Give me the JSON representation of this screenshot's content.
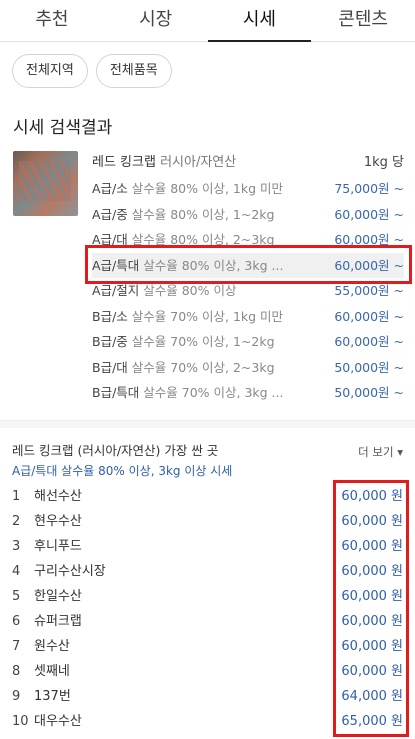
{
  "tabs": [
    "추천",
    "시장",
    "시세",
    "콘텐츠"
  ],
  "active_tab": 2,
  "filters": [
    "전체지역",
    "전체품목"
  ],
  "section_title": "시세 검색결과",
  "product": {
    "name": "레드 킹크랩",
    "origin": "러시아/자연산",
    "unit": "1kg 당"
  },
  "price_rows": [
    {
      "grade": "A급/소",
      "desc": "살수율 80% 이상, 1kg 미만",
      "price": "75,000원 ~"
    },
    {
      "grade": "A급/중",
      "desc": "살수율 80% 이상, 1~2kg",
      "price": "60,000원 ~"
    },
    {
      "grade": "A급/대",
      "desc": "살수율 80% 이상, 2~3kg",
      "price": "60,000원 ~"
    },
    {
      "grade": "A급/특대",
      "desc": "살수율 80% 이상, 3kg ...",
      "price": "60,000원 ~"
    },
    {
      "grade": "A급/절지",
      "desc": "살수율 80% 이상",
      "price": "55,000원 ~"
    },
    {
      "grade": "B급/소",
      "desc": "살수율 70% 이상, 1kg 미만",
      "price": "60,000원 ~"
    },
    {
      "grade": "B급/중",
      "desc": "살수율 70% 이상, 1~2kg",
      "price": "60,000원 ~"
    },
    {
      "grade": "B급/대",
      "desc": "살수율 70% 이상, 2~3kg",
      "price": "50,000원 ~"
    },
    {
      "grade": "B급/특대",
      "desc": "살수율 70% 이상, 3kg ...",
      "price": "50,000원 ~"
    }
  ],
  "cheapest": {
    "heading": "레드 킹크랩 (러시아/자연산) 가장 싼 곳",
    "more": "더 보기 ▾",
    "subheading": "A급/특대 살수율 80% 이상, 3kg 이상 시세",
    "shops": [
      {
        "rank": "1",
        "name": "해선수산",
        "price": "60,000 원"
      },
      {
        "rank": "2",
        "name": "현우수산",
        "price": "60,000 원"
      },
      {
        "rank": "3",
        "name": "후니푸드",
        "price": "60,000 원"
      },
      {
        "rank": "4",
        "name": "구리수산시장",
        "price": "60,000 원"
      },
      {
        "rank": "5",
        "name": "한일수산",
        "price": "60,000 원"
      },
      {
        "rank": "6",
        "name": "슈퍼크랩",
        "price": "60,000 원"
      },
      {
        "rank": "7",
        "name": "원수산",
        "price": "60,000 원"
      },
      {
        "rank": "8",
        "name": "셋째네",
        "price": "60,000 원"
      },
      {
        "rank": "9",
        "name": "137번",
        "price": "64,000 원"
      },
      {
        "rank": "10",
        "name": "대우수산",
        "price": "65,000 원"
      }
    ]
  }
}
